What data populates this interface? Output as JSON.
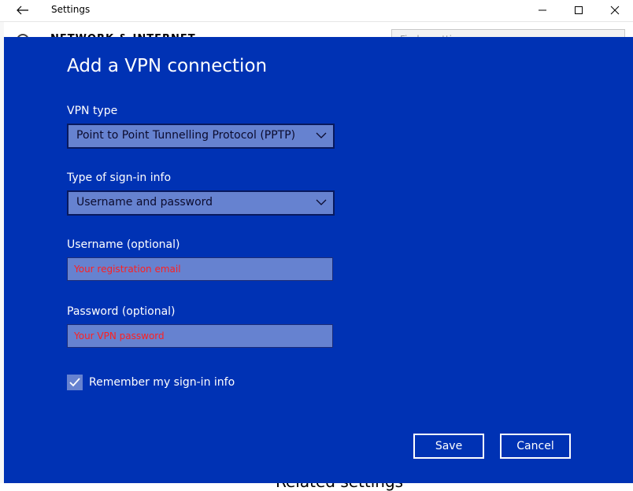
{
  "window": {
    "title": "Settings",
    "back_icon": "arrow-left-icon",
    "minimize_icon": "minimize-icon",
    "maximize_icon": "maximize-icon",
    "close_icon": "close-icon"
  },
  "background": {
    "heading": "NETWORK & INTERNET",
    "search_placeholder": "Find a setting",
    "related_heading": "Related settings"
  },
  "dialog": {
    "title": "Add a VPN connection",
    "vpn_type": {
      "label": "VPN type",
      "value": "Point to Point Tunnelling Protocol (PPTP)"
    },
    "signin_type": {
      "label": "Type of sign-in info",
      "value": "Username and password"
    },
    "username": {
      "label": "Username (optional)",
      "placeholder": "Your registration email"
    },
    "password": {
      "label": "Password (optional)",
      "placeholder": "Your VPN password"
    },
    "remember": {
      "label": "Remember my sign-in info",
      "checked": true
    },
    "save_label": "Save",
    "cancel_label": "Cancel"
  },
  "colors": {
    "dialog_bg": "#0032b4",
    "field_bg": "#6682d0",
    "placeholder_text": "#ff2020",
    "button_border": "#ffffff"
  }
}
